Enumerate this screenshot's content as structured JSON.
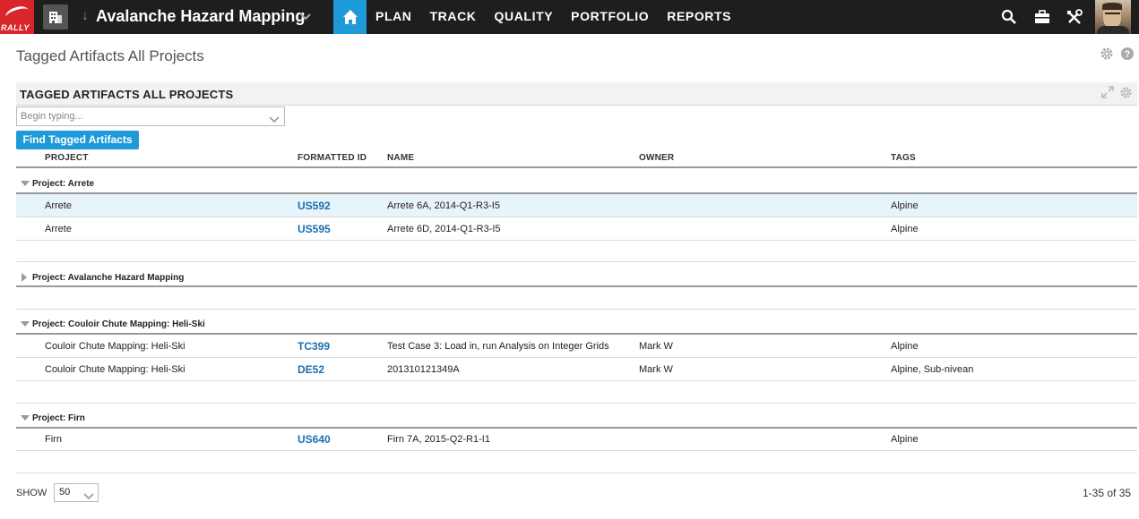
{
  "app": {
    "logo_text": "RALLY"
  },
  "header": {
    "project_title": "Avalanche Hazard Mapping",
    "nav": [
      "PLAN",
      "TRACK",
      "QUALITY",
      "PORTFOLIO",
      "REPORTS"
    ]
  },
  "page": {
    "title": "Tagged Artifacts All Projects"
  },
  "panel": {
    "title": "TAGGED ARTIFACTS ALL PROJECTS",
    "search_placeholder": "Begin typing...",
    "find_button": "Find Tagged Artifacts"
  },
  "columns": [
    "PROJECT",
    "FORMATTED ID",
    "NAME",
    "OWNER",
    "TAGS"
  ],
  "groups": [
    {
      "title": "Project: Arrete",
      "expanded": true,
      "rows": [
        {
          "project": "Arrete",
          "id": "US592",
          "name": "Arrete 6A, 2014-Q1-R3-I5",
          "owner": "",
          "tags": "Alpine",
          "selected": true
        },
        {
          "project": "Arrete",
          "id": "US595",
          "name": "Arrete 6D, 2014-Q1-R3-I5",
          "owner": "",
          "tags": "Alpine",
          "selected": false
        }
      ]
    },
    {
      "title": "Project: Avalanche Hazard Mapping",
      "expanded": false,
      "rows": []
    },
    {
      "title": "Project: Couloir Chute Mapping: Heli-Ski",
      "expanded": true,
      "rows": [
        {
          "project": "Couloir Chute Mapping: Heli-Ski",
          "id": "TC399",
          "name": "Test Case 3: Load in, run Analysis on Integer Grids",
          "owner": "Mark W",
          "tags": "Alpine",
          "selected": false
        },
        {
          "project": "Couloir Chute Mapping: Heli-Ski",
          "id": "DE52",
          "name": "201310121349A",
          "owner": "Mark W",
          "tags": "Alpine, Sub-nivean",
          "selected": false
        }
      ]
    },
    {
      "title": "Project: Firn",
      "expanded": true,
      "rows": [
        {
          "project": "Firn",
          "id": "US640",
          "name": "Firn 7A, 2015-Q2-R1-I1",
          "owner": "",
          "tags": "Alpine",
          "selected": false
        }
      ]
    }
  ],
  "footer": {
    "show_label": "SHOW",
    "page_size": "50",
    "range": "1-35 of 35"
  },
  "colors": {
    "nav_bg": "#1e1e1e",
    "accent": "#1f9ad8",
    "logo_red": "#d9262a",
    "link": "#1a6fb0",
    "selected_row": "#e7f4fb"
  }
}
